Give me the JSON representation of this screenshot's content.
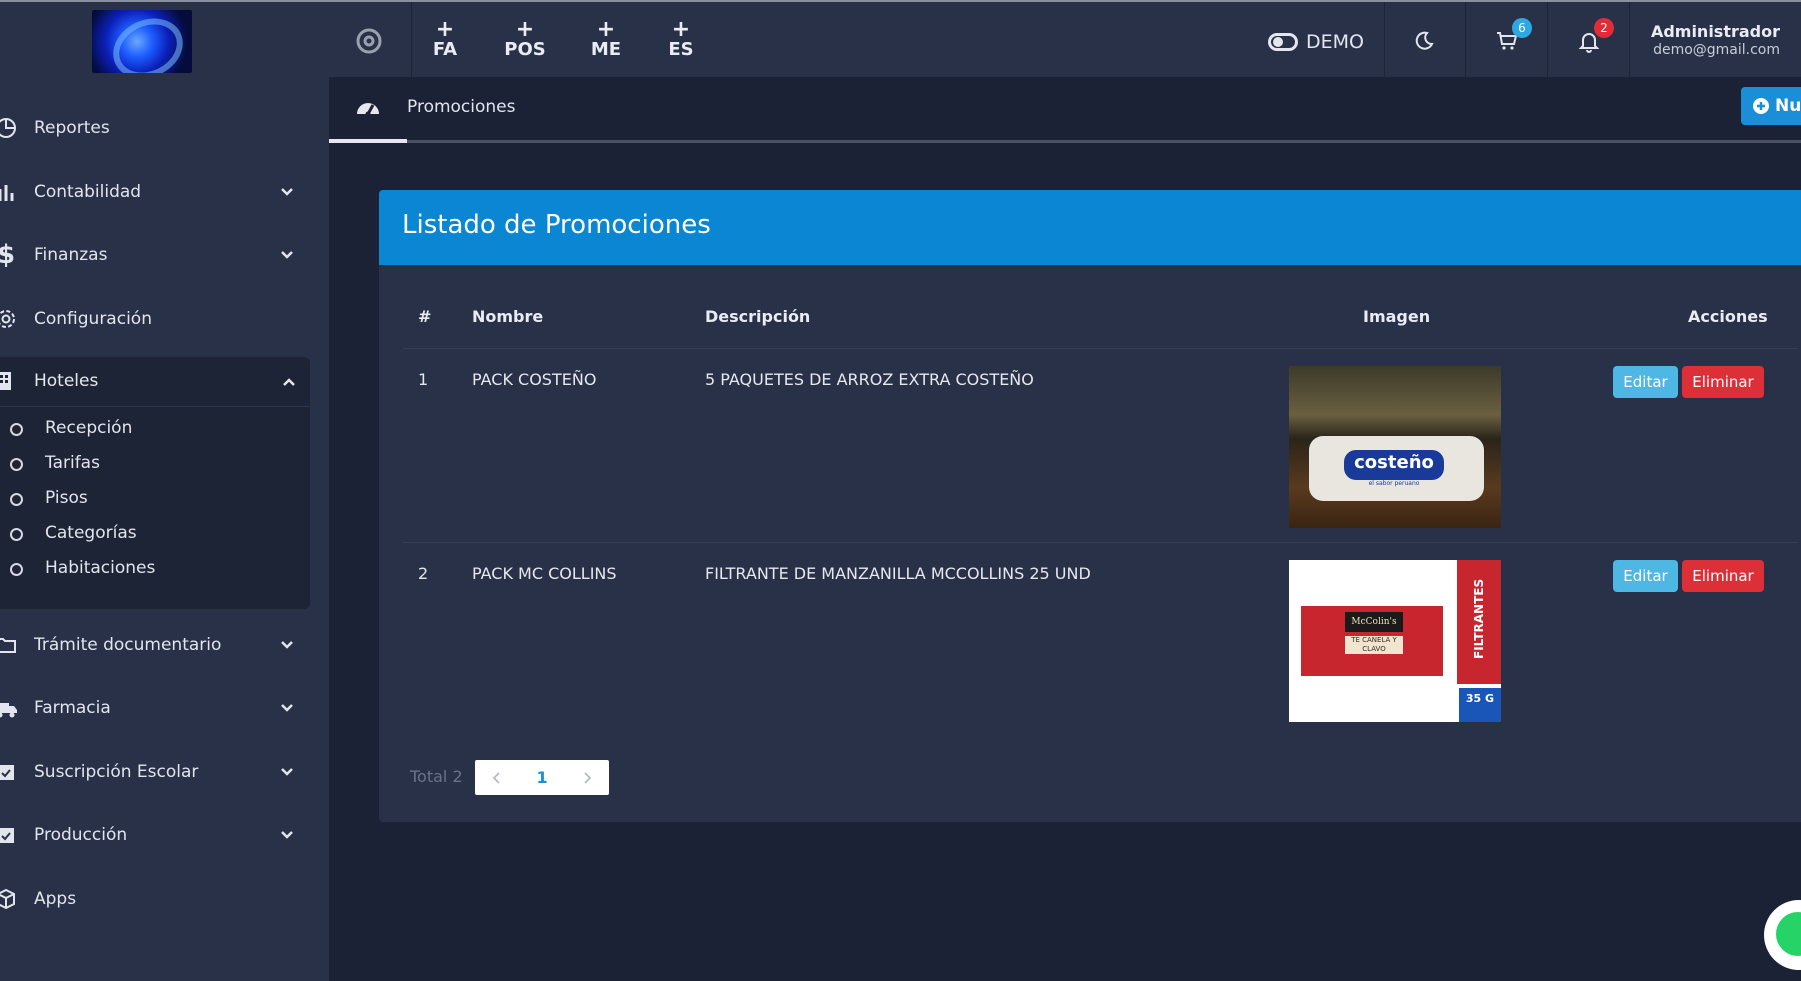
{
  "topbar": {
    "quick_actions": [
      {
        "plus": "+",
        "label": "FA"
      },
      {
        "plus": "+",
        "label": "POS"
      },
      {
        "plus": "+",
        "label": "ME"
      },
      {
        "plus": "+",
        "label": "ES"
      }
    ],
    "demo_label": "DEMO",
    "cart_count": "6",
    "notif_count": "2",
    "user_name": "Administrador",
    "user_email": "demo@gmail.com",
    "colors": {
      "cart_badge": "#2ea8e0",
      "notif_badge": "#e12b36"
    }
  },
  "sidebar": {
    "items": [
      {
        "label": "Reportes",
        "icon": "chart-pie-icon"
      },
      {
        "label": "Contabilidad",
        "icon": "bar-chart-icon"
      },
      {
        "label": "Finanzas",
        "icon": "dollar-icon"
      },
      {
        "label": "Configuración",
        "icon": "gear-icon"
      },
      {
        "label": "Hoteles",
        "icon": "building-icon"
      },
      {
        "label": "Trámite documentario",
        "icon": "folder-icon"
      },
      {
        "label": "Farmacia",
        "icon": "ambulance-icon"
      },
      {
        "label": "Suscripción Escolar",
        "icon": "calendar-check-icon"
      },
      {
        "label": "Producción",
        "icon": "calendar-check-icon"
      },
      {
        "label": "Apps",
        "icon": "cube-icon"
      }
    ],
    "hotel_sub": [
      "Recepción",
      "Tarifas",
      "Pisos",
      "Categorías",
      "Habitaciones"
    ]
  },
  "main": {
    "tab_label": "Promociones",
    "new_button": "Nu",
    "card_title": "Listado de Promociones",
    "headers": [
      "#",
      "Nombre",
      "Descripción",
      "Imagen",
      "Acciones"
    ],
    "rows": [
      {
        "num": "1",
        "name": "PACK COSTEÑO",
        "desc": "5 PAQUETES DE ARROZ EXTRA COSTEÑO",
        "img_brand": "costeño",
        "img_small": "el sabor peruano"
      },
      {
        "num": "2",
        "name": "PACK MC COLLINS",
        "desc": "FILTRANTE DE MANZANILLA MCCOLLINS 25 UND",
        "img_brand": "McColin's",
        "img_flavor": "TÉ CANELA Y CLAVO",
        "img_side": "FILTRANTES",
        "img_weight": "35 G"
      }
    ],
    "edit_label": "Editar",
    "delete_label": "Eliminar",
    "total_label": "Total 2",
    "current_page": "1"
  }
}
